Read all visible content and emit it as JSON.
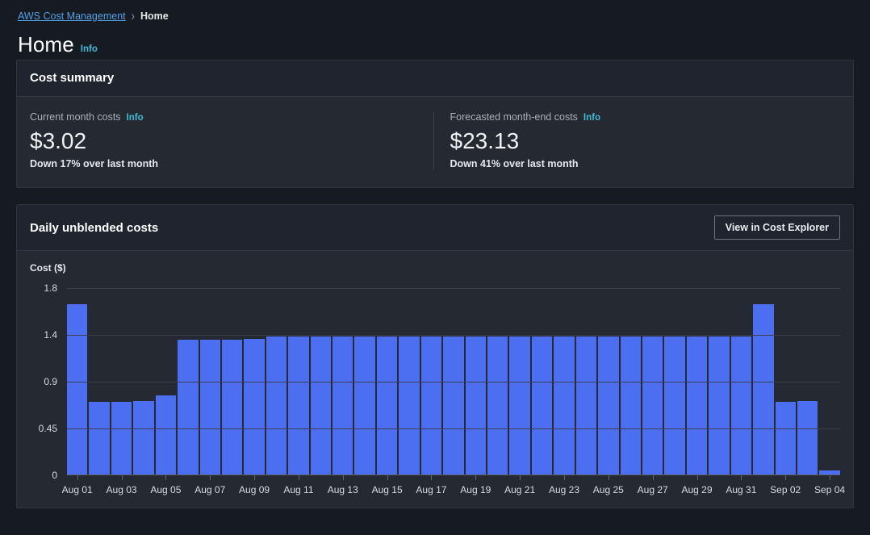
{
  "breadcrumb": {
    "root_label": "AWS Cost Management",
    "separator": "›",
    "current_label": "Home"
  },
  "page": {
    "title": "Home",
    "info_label": "Info"
  },
  "cost_summary": {
    "title": "Cost summary",
    "current": {
      "label": "Current month costs",
      "info_label": "Info",
      "value": "$3.02",
      "delta": "Down 17% over last month"
    },
    "forecast": {
      "label": "Forecasted month-end costs",
      "info_label": "Info",
      "value": "$23.13",
      "delta": "Down 41% over last month"
    }
  },
  "daily_chart": {
    "title": "Daily unblended costs",
    "cost_explorer_button": "View in Cost Explorer"
  },
  "colors": {
    "bar": "#4c6ef0",
    "link": "#539fe5",
    "info": "#44b9d6",
    "card_bg": "#242932",
    "card_header_bg": "#1f242e",
    "page_bg": "#161b22"
  },
  "chart_data": {
    "type": "bar",
    "title": "Daily unblended costs",
    "xlabel": "",
    "ylabel": "Cost ($)",
    "ylim": [
      0,
      1.8
    ],
    "yticks": [
      0,
      0.45,
      0.9,
      1.4,
      1.8
    ],
    "ytick_labels": [
      "0",
      "0.45",
      "0.9",
      "1.4",
      "1.8"
    ],
    "grid": true,
    "legend": false,
    "categories": [
      "Aug 01",
      "Aug 02",
      "Aug 03",
      "Aug 04",
      "Aug 05",
      "Aug 06",
      "Aug 07",
      "Aug 08",
      "Aug 09",
      "Aug 10",
      "Aug 11",
      "Aug 12",
      "Aug 13",
      "Aug 14",
      "Aug 15",
      "Aug 16",
      "Aug 17",
      "Aug 18",
      "Aug 19",
      "Aug 20",
      "Aug 21",
      "Aug 22",
      "Aug 23",
      "Aug 24",
      "Aug 25",
      "Aug 26",
      "Aug 27",
      "Aug 28",
      "Aug 29",
      "Aug 30",
      "Aug 31",
      "Sep 01",
      "Sep 02",
      "Sep 03",
      "Sep 04"
    ],
    "tick_labels_shown": [
      "Aug 01",
      "",
      "Aug 03",
      "",
      "Aug 05",
      "",
      "Aug 07",
      "",
      "Aug 09",
      "",
      "Aug 11",
      "",
      "Aug 13",
      "",
      "Aug 15",
      "",
      "Aug 17",
      "",
      "Aug 19",
      "",
      "Aug 21",
      "",
      "Aug 23",
      "",
      "Aug 25",
      "",
      "Aug 27",
      "",
      "Aug 29",
      "",
      "Aug 31",
      "",
      "Sep 02",
      "",
      "Sep 04"
    ],
    "values": [
      1.66,
      0.7,
      0.7,
      0.71,
      0.76,
      1.34,
      1.34,
      1.34,
      1.35,
      1.38,
      1.38,
      1.38,
      1.38,
      1.38,
      1.38,
      1.38,
      1.38,
      1.38,
      1.38,
      1.38,
      1.38,
      1.38,
      1.38,
      1.38,
      1.38,
      1.38,
      1.38,
      1.38,
      1.38,
      1.38,
      1.38,
      1.66,
      0.7,
      0.71,
      0.04
    ]
  }
}
